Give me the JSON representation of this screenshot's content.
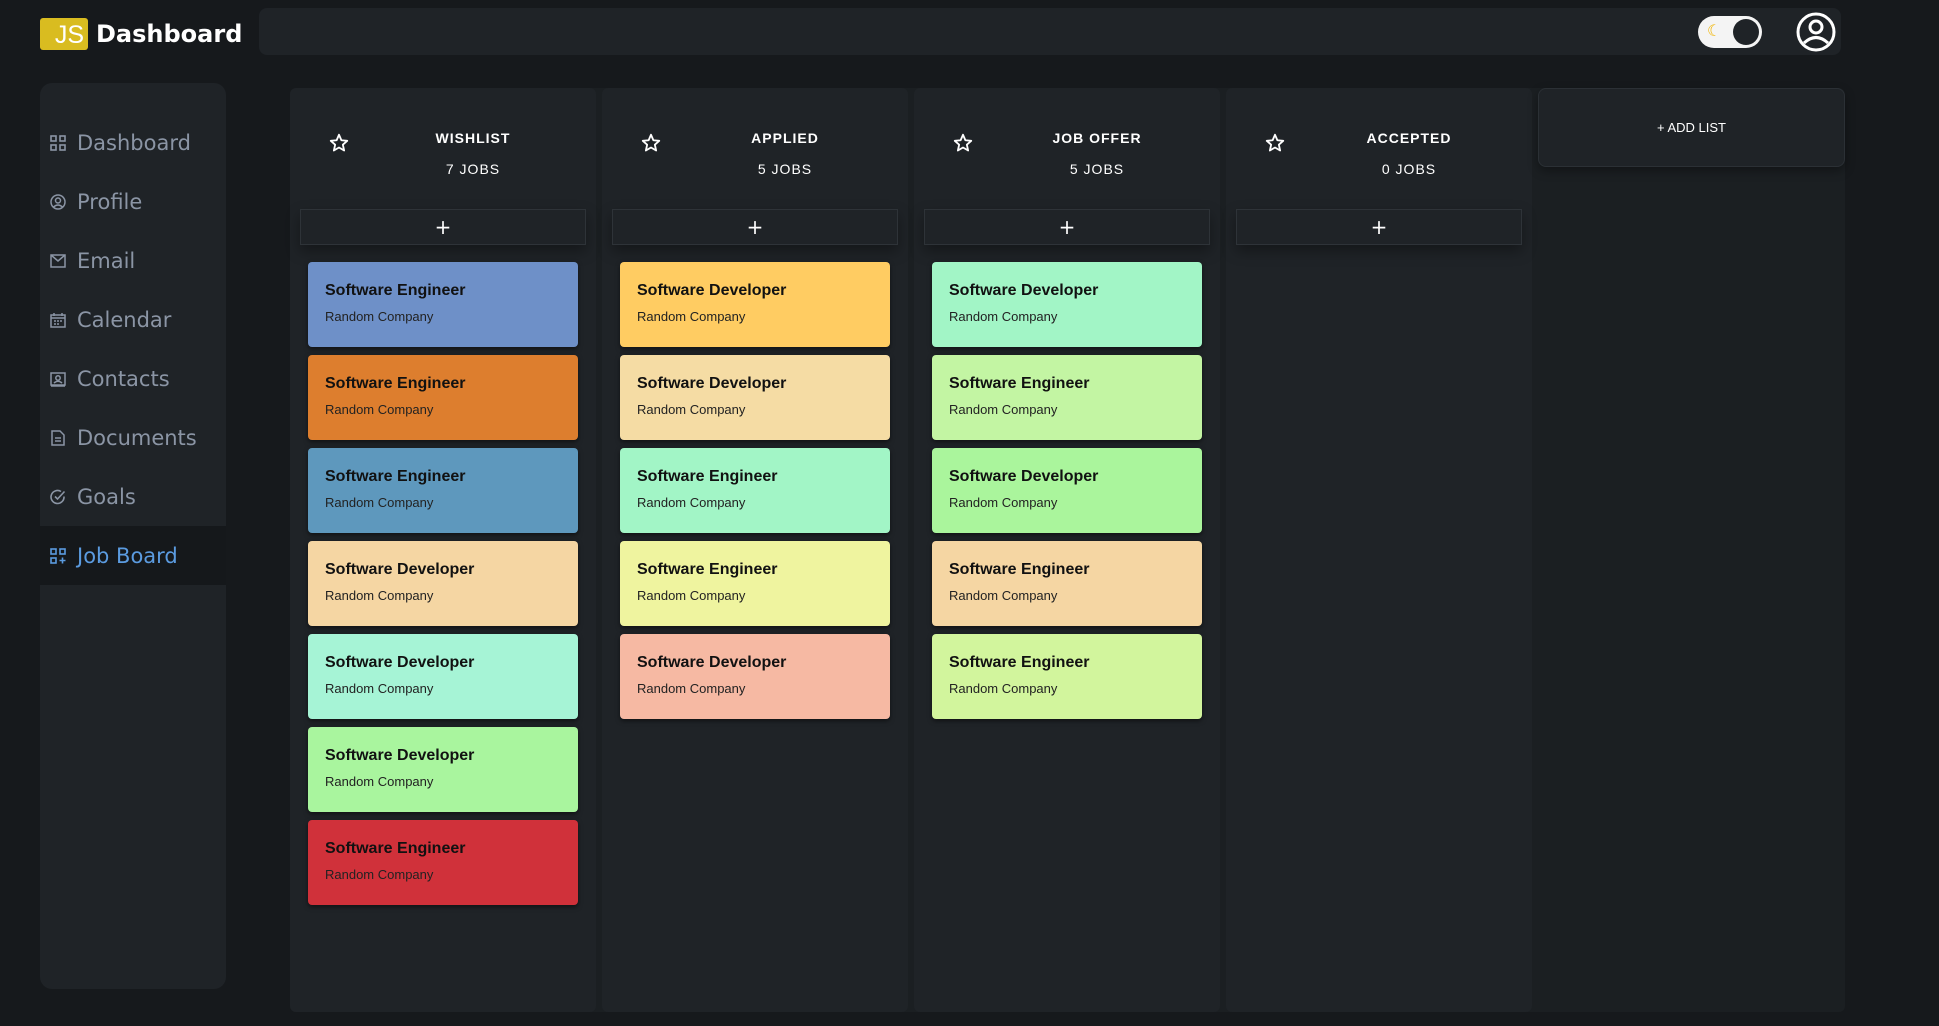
{
  "header": {
    "logo_text": "JS",
    "title": "Dashboard",
    "theme_toggle_icon": "moon-icon",
    "avatar_icon": "user-circle-icon"
  },
  "sidebar": {
    "items": [
      {
        "label": "Dashboard",
        "icon": "grid-icon",
        "active": false
      },
      {
        "label": "Profile",
        "icon": "user-circle-icon",
        "active": false
      },
      {
        "label": "Email",
        "icon": "envelope-icon",
        "active": false
      },
      {
        "label": "Calendar",
        "icon": "calendar-icon",
        "active": false
      },
      {
        "label": "Contacts",
        "icon": "contact-card-icon",
        "active": false
      },
      {
        "label": "Documents",
        "icon": "document-icon",
        "active": false
      },
      {
        "label": "Goals",
        "icon": "check-circle-icon",
        "active": false
      },
      {
        "label": "Job Board",
        "icon": "board-add-icon",
        "active": true
      }
    ]
  },
  "board": {
    "add_button_label": "+",
    "add_list_label": "+ ADD LIST",
    "columns": [
      {
        "title": "WISHLIST",
        "count": "7 JOBS",
        "cards": [
          {
            "title": "Software Engineer",
            "company": "Random Company",
            "color": "#6e90c8"
          },
          {
            "title": "Software Engineer",
            "company": "Random Company",
            "color": "#dd7e2e"
          },
          {
            "title": "Software Engineer",
            "company": "Random Company",
            "color": "#5e98bd"
          },
          {
            "title": "Software Developer",
            "company": "Random Company",
            "color": "#f5d6a3"
          },
          {
            "title": "Software Developer",
            "company": "Random Company",
            "color": "#a6f4d6"
          },
          {
            "title": "Software Developer",
            "company": "Random Company",
            "color": "#a9f59e"
          },
          {
            "title": "Software Engineer",
            "company": "Random Company",
            "color": "#d0313a"
          }
        ]
      },
      {
        "title": "APPLIED",
        "count": "5 JOBS",
        "cards": [
          {
            "title": "Software Developer",
            "company": "Random Company",
            "color": "#ffcc62"
          },
          {
            "title": "Software Developer",
            "company": "Random Company",
            "color": "#f5dca4"
          },
          {
            "title": "Software Engineer",
            "company": "Random Company",
            "color": "#a2f5c6"
          },
          {
            "title": "Software Engineer",
            "company": "Random Company",
            "color": "#eff49f"
          },
          {
            "title": "Software Developer",
            "company": "Random Company",
            "color": "#f6b9a3"
          }
        ]
      },
      {
        "title": "JOB OFFER",
        "count": "5 JOBS",
        "cards": [
          {
            "title": "Software Developer",
            "company": "Random Company",
            "color": "#a2f5c6"
          },
          {
            "title": "Software Engineer",
            "company": "Random Company",
            "color": "#c3f5a3"
          },
          {
            "title": "Software Developer",
            "company": "Random Company",
            "color": "#aaf59c"
          },
          {
            "title": "Software Engineer",
            "company": "Random Company",
            "color": "#f5d6a3"
          },
          {
            "title": "Software Engineer",
            "company": "Random Company",
            "color": "#d2f59d"
          }
        ]
      },
      {
        "title": "ACCEPTED",
        "count": "0 JOBS",
        "cards": []
      }
    ]
  }
}
